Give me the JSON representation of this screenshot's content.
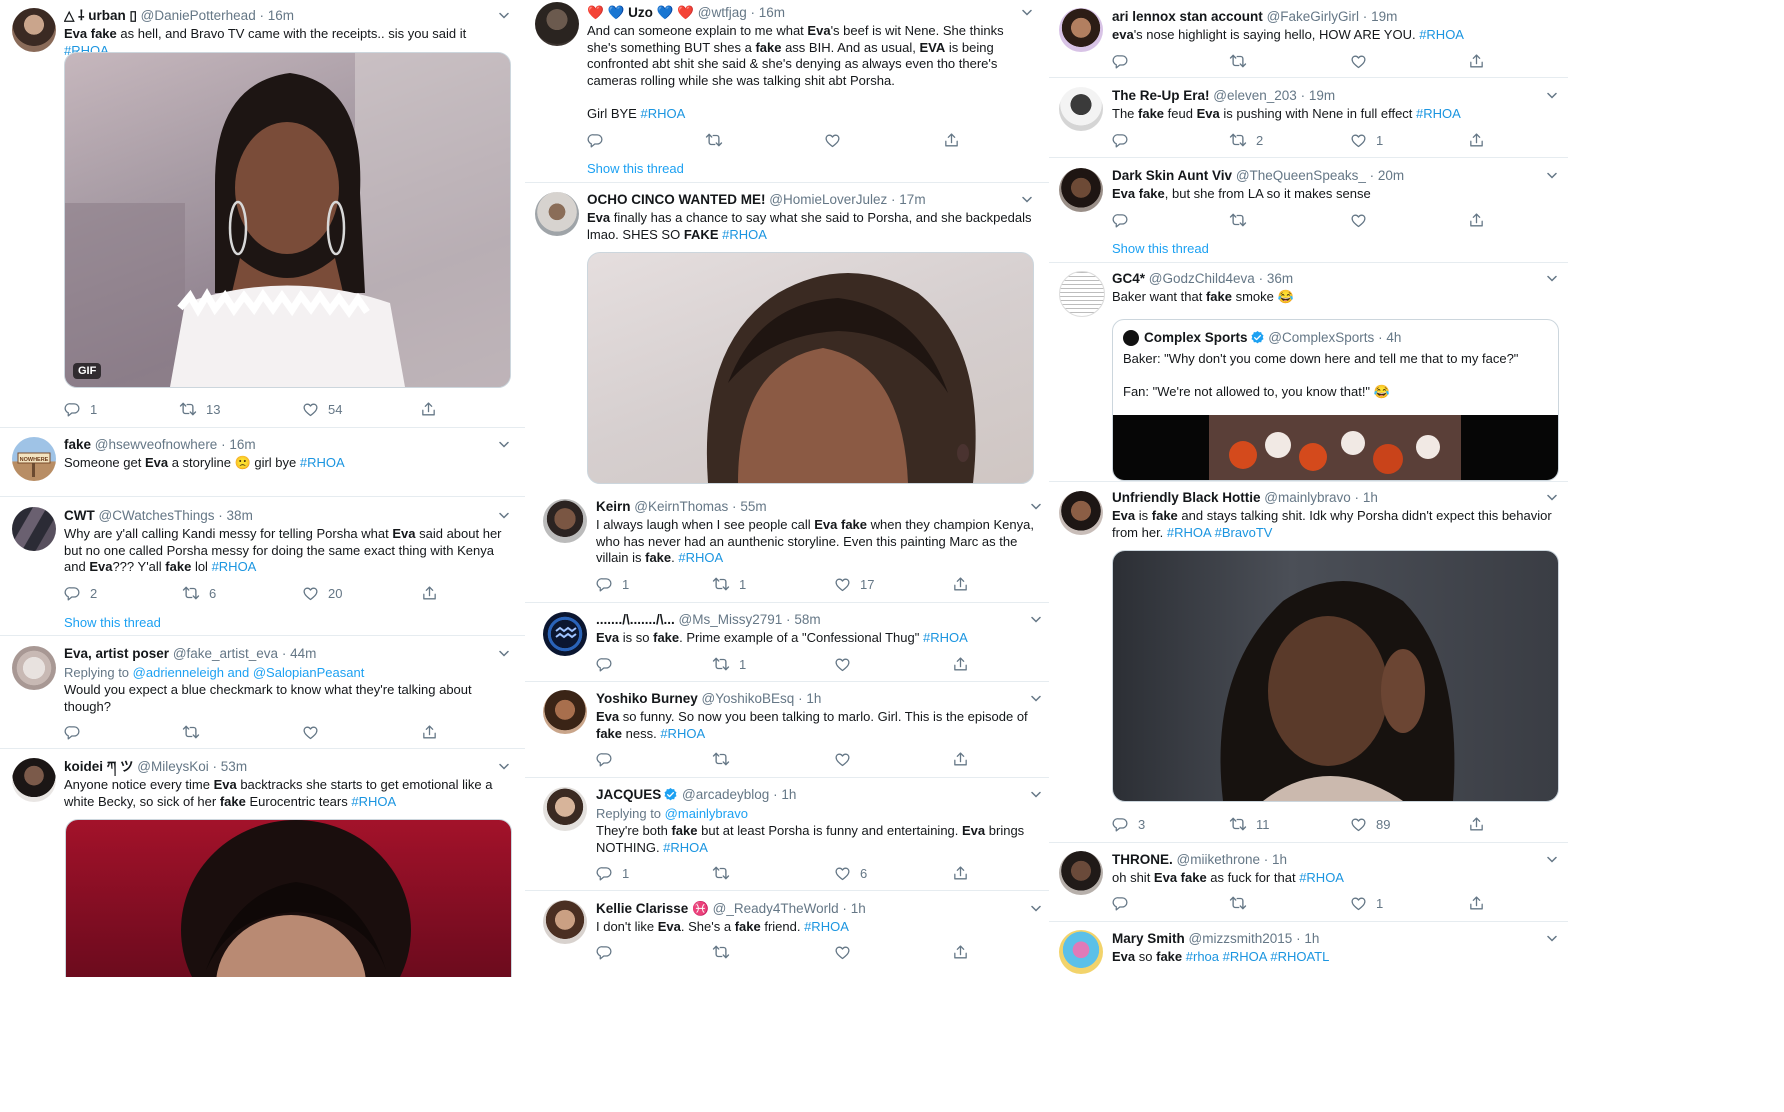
{
  "icons": {
    "reply": "reply-icon",
    "retweet": "retweet-icon",
    "like": "heart-icon",
    "share": "share-icon",
    "caret": "chevron-down-icon"
  },
  "colors": {
    "link": "#1da1f2",
    "hashtag": "#1b95e0",
    "muted": "#657786",
    "text": "#14171a",
    "divider": "#e6ecf0"
  },
  "col0": {
    "t1": {
      "name": "△ ⸸ urban ▯",
      "handle": "@DaniePotterhead",
      "time": "16m",
      "text": [
        {
          "t": "Eva fake",
          "b": 1
        },
        {
          "t": " as hell, and Bravo TV came with the receipts.. sis you said it "
        },
        {
          "t": "#RHOA",
          "h": 1
        }
      ],
      "gif_label": "GIF",
      "reply_count": "1",
      "retweet_count": "13",
      "like_count": "54"
    },
    "t2": {
      "name": "fake",
      "handle": "@hsewveofnowhere",
      "time": "16m",
      "avatar_text": "NOWHERE",
      "text": [
        {
          "t": "Someone get "
        },
        {
          "t": "Eva",
          "b": 1
        },
        {
          "t": " a storyline 🙁 girl bye "
        },
        {
          "t": "#RHOA",
          "h": 1
        }
      ]
    },
    "t3": {
      "name": "CWT",
      "handle": "@CWatchesThings",
      "time": "38m",
      "text": [
        {
          "t": "Why are y'all calling Kandi messy for telling Porsha what "
        },
        {
          "t": "Eva",
          "b": 1
        },
        {
          "t": " said about her\nbut no one called Porsha messy for doing the same exact thing with Kenya\nand "
        },
        {
          "t": "Eva",
          "b": 1
        },
        {
          "t": "??? Y'all "
        },
        {
          "t": "fake",
          "b": 1
        },
        {
          "t": " lol "
        },
        {
          "t": "#RHOA",
          "h": 1
        }
      ],
      "reply_count": "2",
      "retweet_count": "6",
      "like_count": "20",
      "show_thread": "Show this thread"
    },
    "t4": {
      "name": "Eva, artist poser",
      "handle": "@fake_artist_eva",
      "time": "44m",
      "replying_prefix": "Replying to",
      "replying_to": "@adrienneleigh and @SalopianPeasant",
      "text": [
        {
          "t": "Would you expect a blue checkmark to know what they're talking about\nthough?"
        }
      ]
    },
    "t5": {
      "name": "koidei ཀ ツ",
      "handle": "@MileysKoi",
      "time": "53m",
      "text": [
        {
          "t": "Anyone notice every time "
        },
        {
          "t": "Eva",
          "b": 1
        },
        {
          "t": " backtracks she starts to get emotional like a\nwhite Becky, so sick of her "
        },
        {
          "t": "fake",
          "b": 1
        },
        {
          "t": " Eurocentric tears "
        },
        {
          "t": "#RHOA",
          "h": 1
        }
      ]
    }
  },
  "col1": {
    "t1": {
      "name": "❤️ 💙 Uzo 💙 ❤️",
      "handle": "@wtfjag",
      "time": "16m",
      "text": [
        {
          "t": "And can someone explain to me what "
        },
        {
          "t": "Eva",
          "b": 1
        },
        {
          "t": "'s beef is wit Nene. She thinks\nshe's something BUT shes a "
        },
        {
          "t": "fake",
          "b": 1
        },
        {
          "t": " ass BIH. And as usual, "
        },
        {
          "t": "EVA",
          "b": 1
        },
        {
          "t": " is being\nconfronted abt shit she said & she's denying as always even tho there's\ncameras rolling while she was talking shit abt Porsha.\n\nGirl BYE "
        },
        {
          "t": "#RHOA",
          "h": 1
        }
      ],
      "show_thread": "Show this thread"
    },
    "t2": {
      "name": "OCHO CINCO WANTED ME!",
      "handle": "@HomieLoverJulez",
      "time": "17m",
      "text": [
        {
          "t": "Eva",
          "b": 1
        },
        {
          "t": " finally has a chance to say what she said to Porsha, and she backpedals\nlmao. SHES SO "
        },
        {
          "t": "FAKE",
          "b": 1
        },
        {
          "t": " "
        },
        {
          "t": "#RHOA",
          "h": 1
        }
      ]
    },
    "t3": {
      "name": "Keirn",
      "handle": "@KeirnThomas",
      "time": "55m",
      "text": [
        {
          "t": "I always laugh when I see people call "
        },
        {
          "t": "Eva fake",
          "b": 1
        },
        {
          "t": " when they champion Kenya,\nwho has never had an aunthenic storyline. Even this painting Marc as the\nvillain is "
        },
        {
          "t": "fake",
          "b": 1
        },
        {
          "t": ". "
        },
        {
          "t": "#RHOA",
          "h": 1
        }
      ],
      "reply_count": "1",
      "retweet_count": "1",
      "like_count": "17"
    },
    "t4": {
      "name": "......./\\......./\\...",
      "handle": "@Ms_Missy2791",
      "time": "58m",
      "text": [
        {
          "t": "Eva",
          "b": 1
        },
        {
          "t": " is so "
        },
        {
          "t": "fake",
          "b": 1
        },
        {
          "t": ". Prime example of a \"Confessional Thug\" "
        },
        {
          "t": "#RHOA",
          "h": 1
        }
      ],
      "retweet_count": "1"
    },
    "t5": {
      "name": "Yoshiko Burney",
      "handle": "@YoshikoBEsq",
      "time": "1h",
      "text": [
        {
          "t": "Eva",
          "b": 1
        },
        {
          "t": " so funny. So now you been talking to marlo. Girl. This is the episode of\n"
        },
        {
          "t": "fake",
          "b": 1
        },
        {
          "t": " ness.  "
        },
        {
          "t": "#RHOA",
          "h": 1
        }
      ]
    },
    "t6": {
      "name": "JACQUES",
      "handle": "@arcadeyblog",
      "time": "1h",
      "replying_prefix": "Replying to",
      "replying_to": "@mainlybravo",
      "text": [
        {
          "t": "They're both "
        },
        {
          "t": "fake",
          "b": 1
        },
        {
          "t": " but at least Porsha is funny and entertaining. "
        },
        {
          "t": "Eva",
          "b": 1
        },
        {
          "t": " brings\nNOTHING. "
        },
        {
          "t": "#RHOA",
          "h": 1
        }
      ],
      "reply_count": "1",
      "like_count": "6"
    },
    "t7": {
      "name": "Kellie Clarisse ♓",
      "handle": "@_Ready4TheWorld",
      "time": "1h",
      "text": [
        {
          "t": "I don't like "
        },
        {
          "t": "Eva",
          "b": 1
        },
        {
          "t": ". She's a "
        },
        {
          "t": "fake",
          "b": 1
        },
        {
          "t": " friend.  "
        },
        {
          "t": "#RHOA",
          "h": 1
        }
      ]
    }
  },
  "col2": {
    "t1": {
      "name": "ari lennox stan account",
      "handle": "@FakeGirlyGirl",
      "time": "19m",
      "text": [
        {
          "t": "eva",
          "b": 1
        },
        {
          "t": "'s nose highlight is saying hello, HOW ARE YOU. "
        },
        {
          "t": "#RHOA",
          "h": 1
        }
      ]
    },
    "t2": {
      "name": "The Re-Up Era!",
      "handle": "@eleven_203",
      "time": "19m",
      "text": [
        {
          "t": "The "
        },
        {
          "t": "fake",
          "b": 1
        },
        {
          "t": " feud "
        },
        {
          "t": "Eva",
          "b": 1
        },
        {
          "t": " is pushing with Nene in full effect "
        },
        {
          "t": "#RHOA",
          "h": 1
        }
      ],
      "retweet_count": "2",
      "like_count": "1"
    },
    "t3": {
      "name": "Dark Skin Aunt Viv",
      "handle": "@TheQueenSpeaks_",
      "time": "20m",
      "text": [
        {
          "t": "Eva fake",
          "b": 1
        },
        {
          "t": ", but she from LA so it makes sense"
        }
      ],
      "show_thread": "Show this thread"
    },
    "t4": {
      "name": "GC4*",
      "handle": "@GodzChild4eva",
      "time": "36m",
      "text": [
        {
          "t": "Baker want that "
        },
        {
          "t": "fake",
          "b": 1
        },
        {
          "t": " smoke 😂"
        }
      ],
      "quote_name": "Complex Sports",
      "quote_handle": "@ComplexSports",
      "quote_time": "4h",
      "quote_text": "Baker: \"Why don't you come down here and tell me that to my face?\"\n\nFan: \"We're not allowed to, you know that!\" 😂"
    },
    "t5": {
      "name": "Unfriendly Black Hottie",
      "handle": "@mainlybravo",
      "time": "1h",
      "text": [
        {
          "t": "Eva",
          "b": 1
        },
        {
          "t": " is "
        },
        {
          "t": "fake",
          "b": 1
        },
        {
          "t": " and stays talking shit. Idk why Porsha didn't expect this behavior\nfrom her. "
        },
        {
          "t": "#RHOA",
          "h": 1
        },
        {
          "t": " "
        },
        {
          "t": "#BravoTV",
          "h": 1
        }
      ],
      "reply_count": "3",
      "retweet_count": "11",
      "like_count": "89"
    },
    "t6": {
      "name": "THRONE.",
      "handle": "@miikethrone",
      "time": "1h",
      "text": [
        {
          "t": "oh shit "
        },
        {
          "t": "Eva fake",
          "b": 1
        },
        {
          "t": " as fuck for that "
        },
        {
          "t": "#RHOA",
          "h": 1
        }
      ],
      "like_count": "1"
    },
    "t7": {
      "name": "Mary Smith",
      "handle": "@mizzsmith2015",
      "time": "1h",
      "text": [
        {
          "t": "Eva",
          "b": 1
        },
        {
          "t": " so "
        },
        {
          "t": "fake",
          "b": 1
        },
        {
          "t": " "
        },
        {
          "t": "#rhoa",
          "h": 1
        },
        {
          "t": " "
        },
        {
          "t": "#RHOA",
          "h": 1
        },
        {
          "t": " "
        },
        {
          "t": "#RHOATL",
          "h": 1
        }
      ]
    }
  }
}
